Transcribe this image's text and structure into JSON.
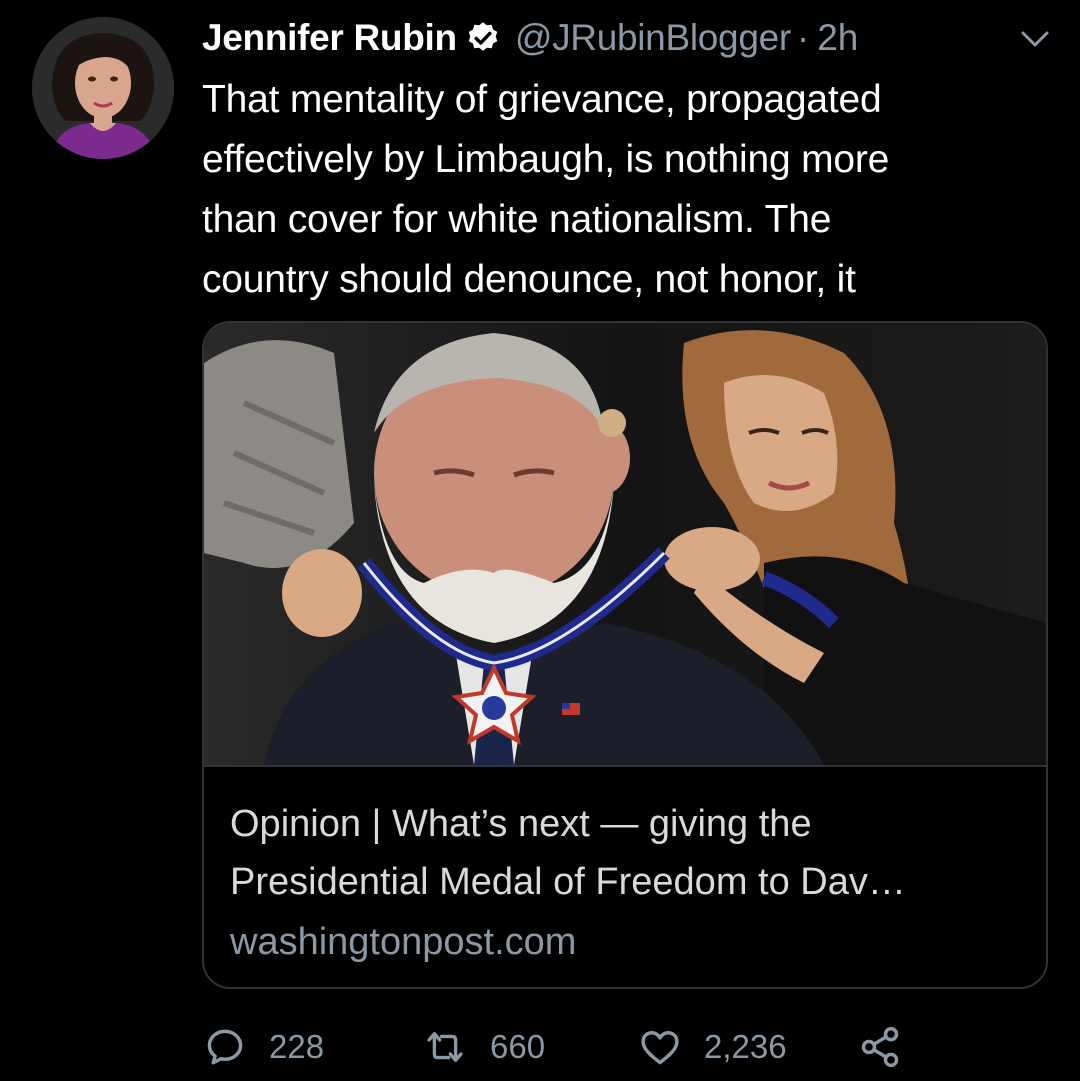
{
  "tweet": {
    "author": {
      "display_name": "Jennifer Rubin",
      "handle": "@JRubinBlogger",
      "verified": true,
      "avatar_icon": "profile-photo"
    },
    "separator": "·",
    "time": "2h",
    "text_lines": [
      "That mentality of grievance, propagated",
      "effectively by Limbaugh, is nothing more",
      "than cover for white nationalism. The",
      "country should denounce, not honor, it"
    ],
    "card": {
      "image_icon": "medal-ceremony-photo",
      "title_lines": [
        "Opinion | What’s next — giving the",
        "Presidential Medal of Freedom to Dav…"
      ],
      "domain": "washingtonpost.com"
    },
    "actions": {
      "replies": "228",
      "retweets": "660",
      "likes": "2,236"
    }
  },
  "colors": {
    "background": "#000000",
    "primary_text": "#ffffff",
    "secondary_text": "#8b98a5",
    "border": "#2f3336"
  }
}
